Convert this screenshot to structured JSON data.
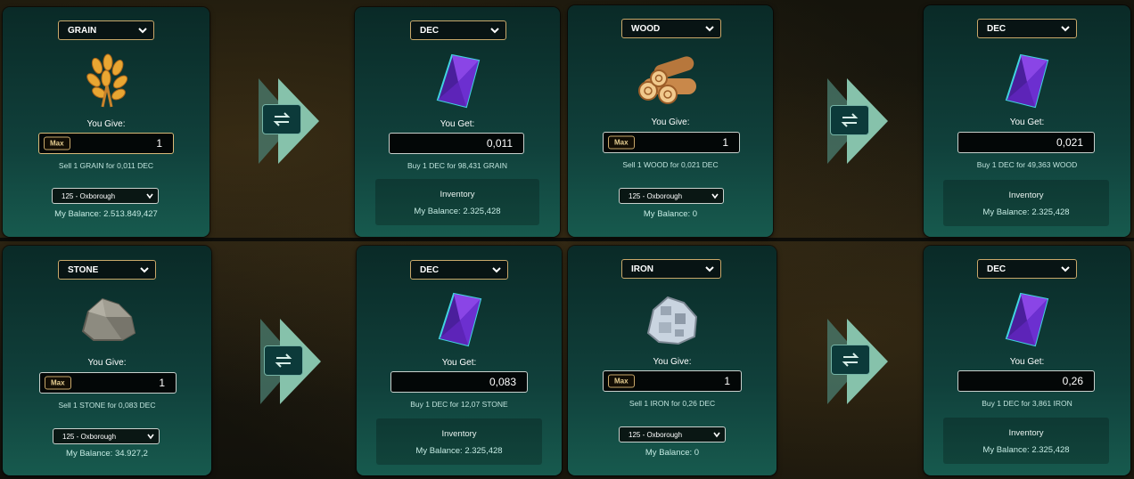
{
  "converters": [
    {
      "give": {
        "resource": "GRAIN",
        "label": "You Give:",
        "max_label": "Max",
        "amount": "1",
        "rate": "Sell 1 GRAIN for 0,011 DEC",
        "city": "125 - Oxborough",
        "balance": "My Balance: 2.513.849,427",
        "icon": "grain-icon"
      },
      "get": {
        "resource": "DEC",
        "label": "You Get:",
        "amount": "0,011",
        "rate": "Buy 1 DEC for 98,431 GRAIN",
        "inventory_label": "Inventory",
        "balance": "My Balance: 2.325,428",
        "icon": "dec-crystal-icon"
      }
    },
    {
      "give": {
        "resource": "WOOD",
        "label": "You Give:",
        "max_label": "Max",
        "amount": "1",
        "rate": "Sell 1 WOOD for 0,021 DEC",
        "city": "125 - Oxborough",
        "balance": "My Balance: 0",
        "icon": "wood-icon"
      },
      "get": {
        "resource": "DEC",
        "label": "You Get:",
        "amount": "0,021",
        "rate": "Buy 1 DEC for 49,363 WOOD",
        "inventory_label": "Inventory",
        "balance": "My Balance: 2.325,428",
        "icon": "dec-crystal-icon"
      }
    },
    {
      "give": {
        "resource": "STONE",
        "label": "You Give:",
        "max_label": "Max",
        "amount": "1",
        "rate": "Sell 1 STONE for 0,083 DEC",
        "city": "125 - Oxborough",
        "balance": "My Balance: 34.927,2",
        "icon": "stone-icon"
      },
      "get": {
        "resource": "DEC",
        "label": "You Get:",
        "amount": "0,083",
        "rate": "Buy 1 DEC for 12,07 STONE",
        "inventory_label": "Inventory",
        "balance": "My Balance: 2.325,428",
        "icon": "dec-crystal-icon"
      }
    },
    {
      "give": {
        "resource": "IRON",
        "label": "You Give:",
        "max_label": "Max",
        "amount": "1",
        "rate": "Sell 1 IRON for 0,26 DEC",
        "city": "125 - Oxborough",
        "balance": "My Balance: 0",
        "icon": "iron-icon"
      },
      "get": {
        "resource": "DEC",
        "label": "You Get:",
        "amount": "0,26",
        "rate": "Buy 1 DEC for 3,861 IRON",
        "inventory_label": "Inventory",
        "balance": "My Balance: 2.325,428",
        "icon": "dec-crystal-icon"
      }
    }
  ],
  "colors": {
    "panel": "#10403b",
    "accent_gold": "#c9a86a",
    "arrow": "#7fb9a2"
  }
}
